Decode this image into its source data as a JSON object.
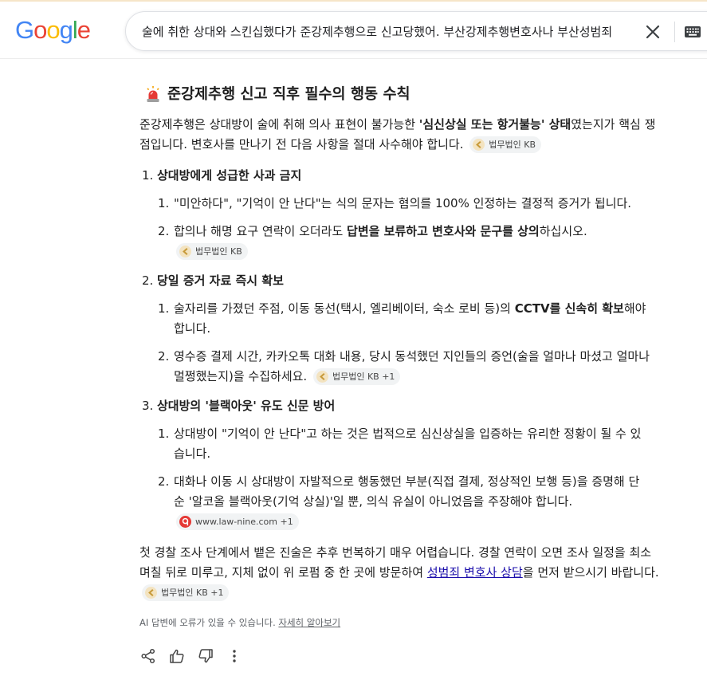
{
  "header": {
    "logo_letters": [
      "G",
      "o",
      "o",
      "g",
      "l",
      "e"
    ],
    "logo_colors": [
      "#4285F4",
      "#EA4335",
      "#FBBC05",
      "#4285F4",
      "#34A853",
      "#EA4335"
    ],
    "query": "술에 취한 상대와 스킨십했다가 준강제추행으로 신고당했어. 부산강제추행변호사나 부산성범죄"
  },
  "answer": {
    "heading": "준강제추행 신고 직후 필수의 행동 수칙",
    "intro": {
      "before": "준강제추행은 상대방이 술에 취해 의사 표현이 불가능한 ",
      "bold": "'심신상실 또는 항거불능' 상태",
      "after": "였는지가 핵심 쟁점입니다. 변호사를 만나기 전 다음 사항을 절대 사수해야 합니다.",
      "chip": "법무법인 KB"
    },
    "sections": [
      {
        "num": "1.",
        "title": "상대방에게 성급한 사과 금지",
        "items": [
          {
            "num": "1.",
            "text": "\"미안하다\", \"기억이 안 난다\"는 식의 문자는 혐의를 100% 인정하는 결정적 증거가 됩니다."
          },
          {
            "num": "2.",
            "before": "합의나 해명 요구 연락이 오더라도 ",
            "bold": "답변을 보류하고 변호사와 문구를 상의",
            "after": "하십시오.",
            "chip": "법무법인 KB"
          }
        ]
      },
      {
        "num": "2.",
        "title": "당일 증거 자료 즉시 확보",
        "items": [
          {
            "num": "1.",
            "before": "술자리를 가졌던 주점, 이동 동선(택시, 엘리베이터, 숙소 로비 등)의 ",
            "bold": "CCTV를 신속히 확보",
            "after": "해야 합니다."
          },
          {
            "num": "2.",
            "text": "영수증 결제 시간, 카카오톡 대화 내용, 당시 동석했던 지인들의 증언(술을 얼마나 마셨고 얼마나 멀쩡했는지)을 수집하세요.",
            "chip": "법무법인 KB +1"
          }
        ]
      },
      {
        "num": "3.",
        "title": "상대방의 '블랙아웃' 유도 신문 방어",
        "items": [
          {
            "num": "1.",
            "text": "상대방이 \"기억이 안 난다\"고 하는 것은 법적으로 심신상실을 입증하는 유리한 정황이 될 수 있습니다."
          },
          {
            "num": "2.",
            "text": "대화나 이동 시 상대방이 자발적으로 행동했던 부분(직접 결제, 정상적인 보행 등)을 증명해 단순 '알코올 블랙아웃(기억 상실)'일 뿐, 의식 유실이 아니었음을 주장해야 합니다.",
            "chip": "www.law-nine.com +1",
            "chip_icon": "law-nine"
          }
        ]
      }
    ],
    "closing": {
      "before": "첫 경찰 조사 단계에서 뱉은 진술은 추후 번복하기 매우 어렵습니다. 경찰 연락이 오면 조사 일정을 최소 며칠 뒤로 미루고, 지체 없이 위 로펌 중 한 곳에 방문하여 ",
      "link": "성범죄 변호사 상담",
      "after": "을 먼저 받으시기 바랍니다.",
      "chip": "법무법인 KB +1"
    },
    "disclaimer": {
      "text": "AI 답변에 오류가 있을 수 있습니다. ",
      "link": "자세히 알아보기"
    }
  },
  "icons": {
    "siren": "siren-emoji-icon",
    "clear": "close-icon",
    "keyboard": "keyboard-icon",
    "share": "share-icon",
    "thumbs_up": "thumbs-up-icon",
    "thumbs_down": "thumbs-down-icon",
    "more": "more-vert-icon"
  }
}
